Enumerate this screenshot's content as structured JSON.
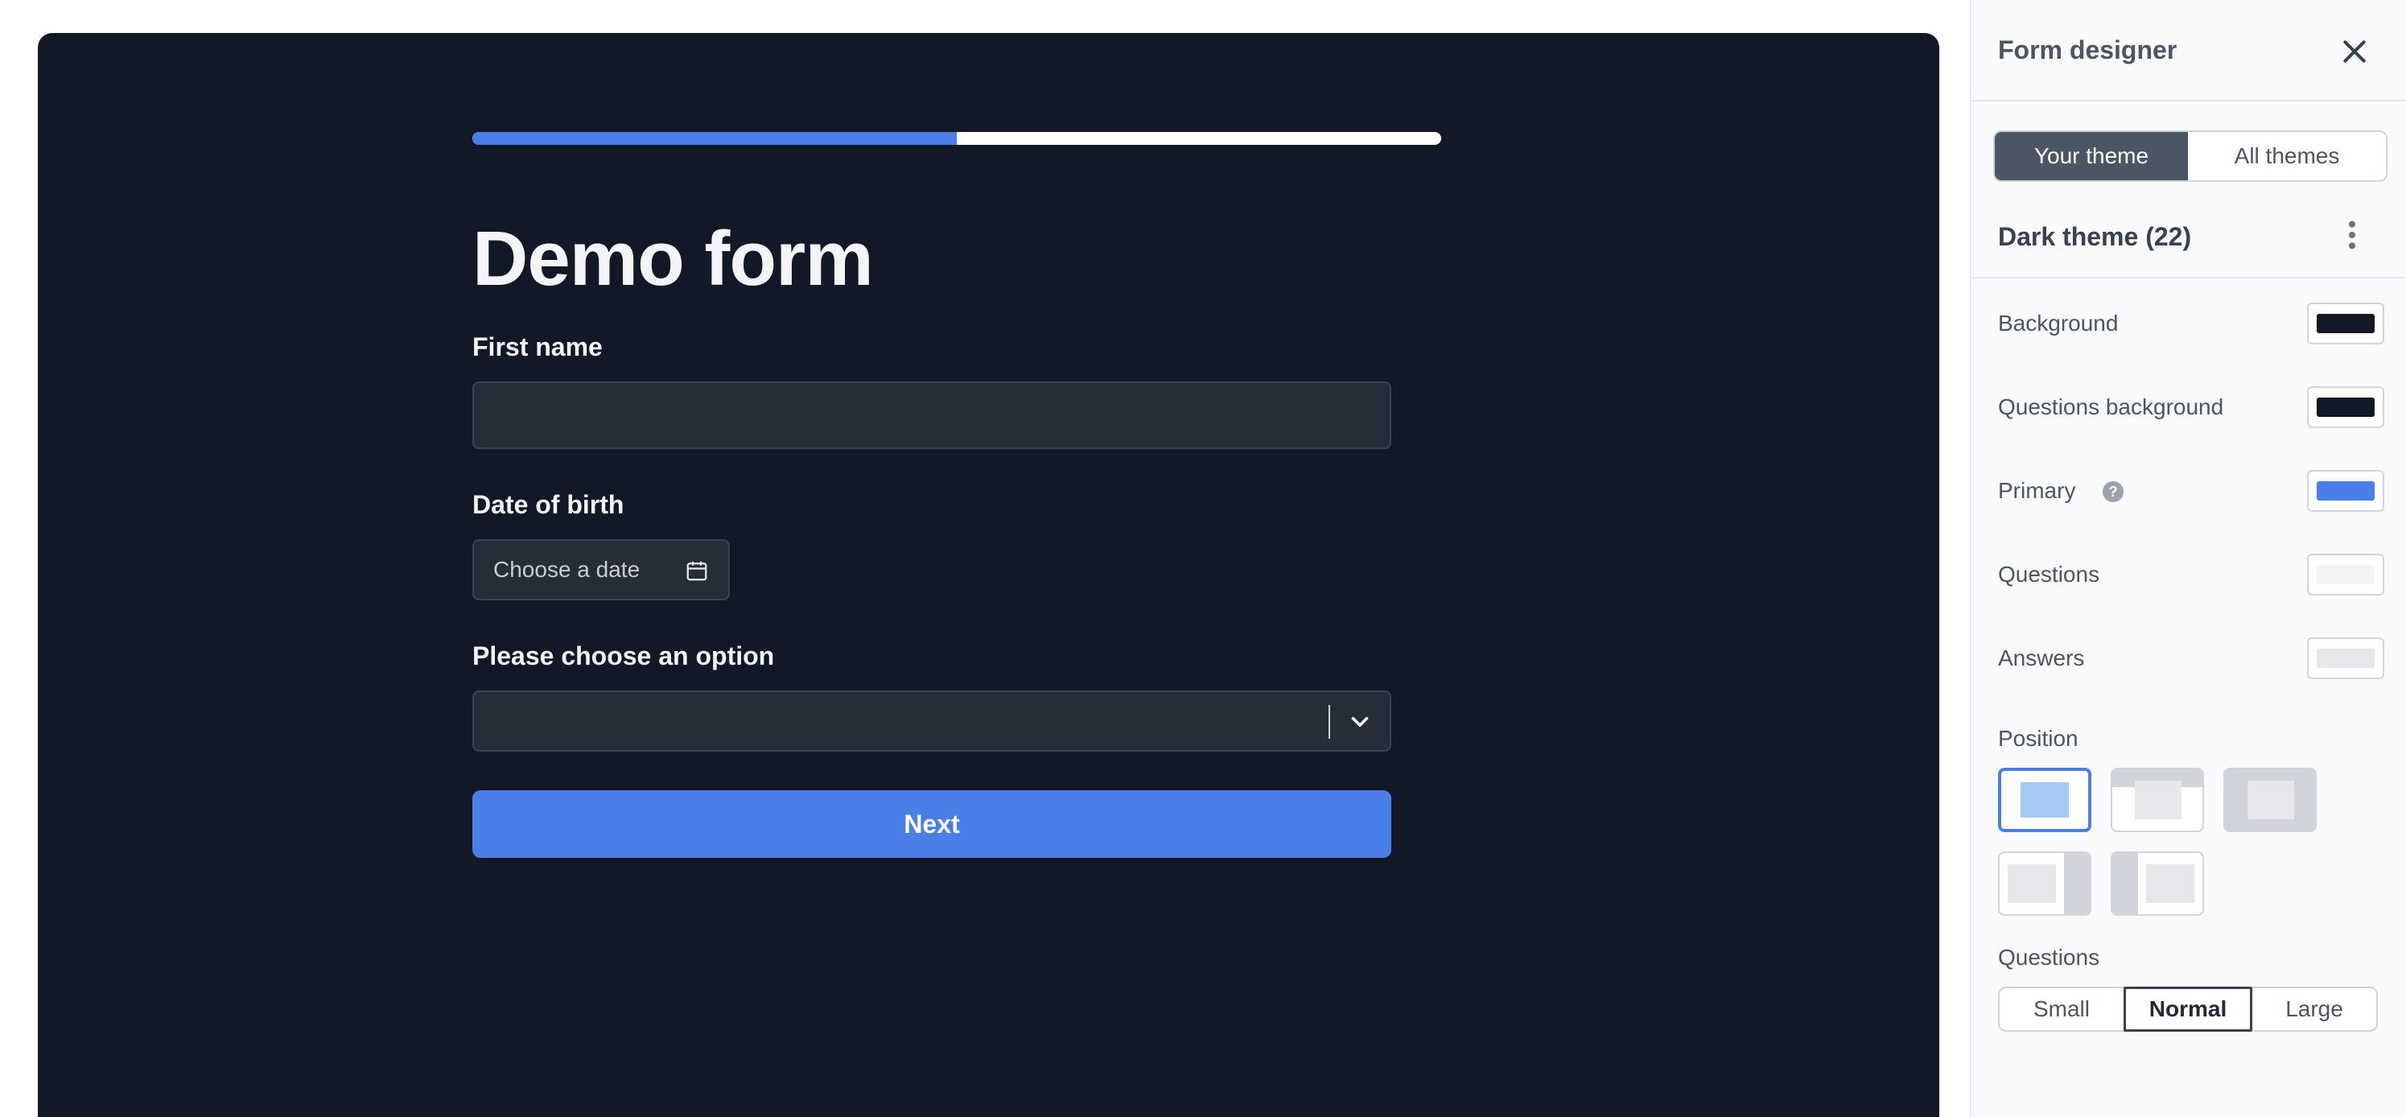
{
  "form": {
    "progress_fraction": 0.5,
    "title": "Demo form",
    "first_name_label": "First name",
    "dob_label": "Date of birth",
    "dob_placeholder": "Choose a date",
    "option_label": "Please choose an option",
    "next_label": "Next"
  },
  "panel": {
    "title": "Form designer",
    "tabs": [
      {
        "label": "Your theme",
        "active": true
      },
      {
        "label": "All themes",
        "active": false
      }
    ],
    "theme_name": "Dark theme (22)",
    "colors": [
      {
        "label": "Background",
        "value": "#131826"
      },
      {
        "label": "Questions background",
        "value": "#131826"
      },
      {
        "label": "Primary",
        "value": "#4a7fe8",
        "help": "?"
      },
      {
        "label": "Questions",
        "value": "#f3f4f6"
      },
      {
        "label": "Answers",
        "value": "#e5e7eb"
      }
    ],
    "position_label": "Position",
    "questions_label": "Questions",
    "size_options": [
      {
        "label": "Small",
        "active": false
      },
      {
        "label": "Normal",
        "active": true
      },
      {
        "label": "Large",
        "active": false
      }
    ]
  },
  "icons": {
    "close": "close-icon",
    "kebab": "kebab-icon",
    "calendar": "calendar-icon",
    "chevron": "chevron-down-icon",
    "help": "help-icon"
  }
}
